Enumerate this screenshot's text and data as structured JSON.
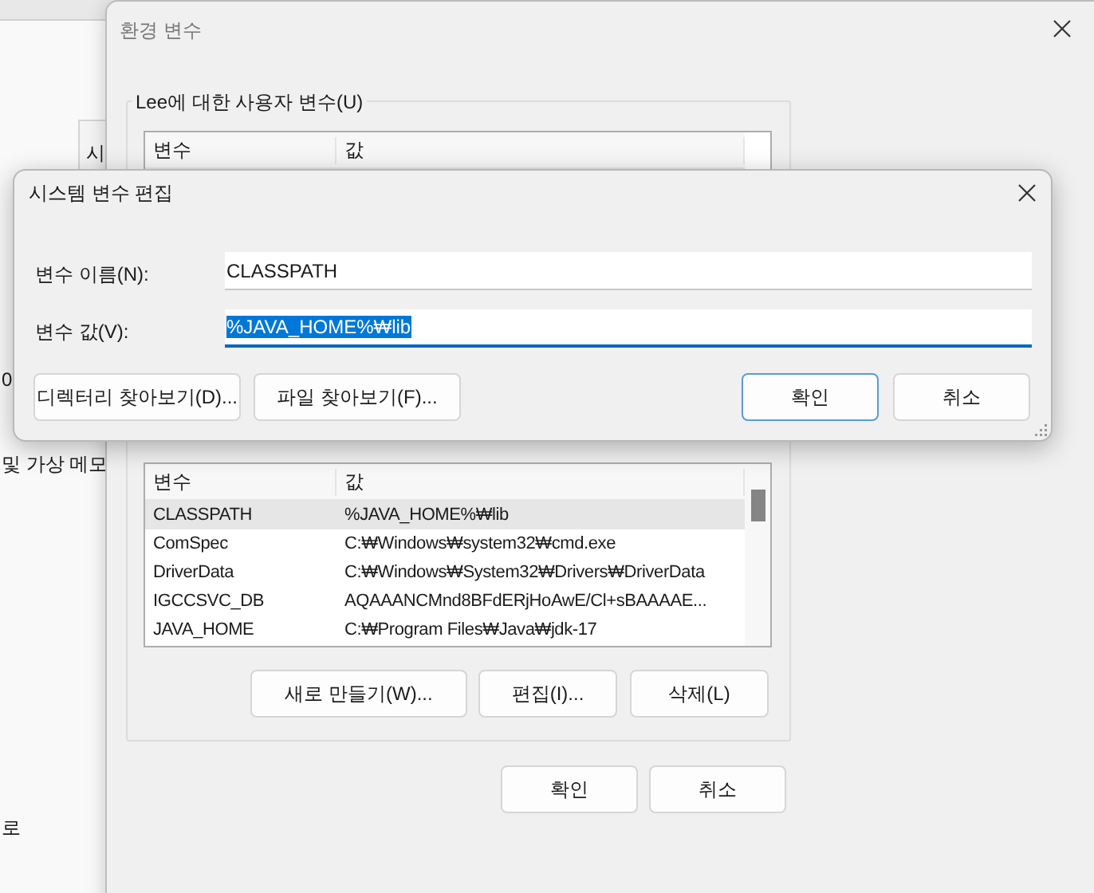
{
  "back_window": {
    "tab_fragment": "시",
    "texts": [
      "0",
      "및 가상 메모",
      "로"
    ]
  },
  "env_window": {
    "title": "환경 변수",
    "user_group": {
      "label": "Lee에 대한 사용자 변수(U)",
      "columns": [
        "변수",
        "값"
      ]
    },
    "system_table": {
      "columns": [
        "변수",
        "값"
      ],
      "rows": [
        {
          "name": "CLASSPATH",
          "value": "%JAVA_HOME%₩lib",
          "selected": true
        },
        {
          "name": "ComSpec",
          "value": "C:₩Windows₩system32₩cmd.exe",
          "selected": false
        },
        {
          "name": "DriverData",
          "value": "C:₩Windows₩System32₩Drivers₩DriverData",
          "selected": false
        },
        {
          "name": "IGCCSVC_DB",
          "value": "AQAAANCMnd8BFdERjHoAwE/Cl+sBAAAAE...",
          "selected": false
        },
        {
          "name": "JAVA_HOME",
          "value": "C:₩Program Files₩Java₩jdk-17",
          "selected": false
        }
      ]
    },
    "group_buttons": [
      "새로 만들기(W)...",
      "편집(I)...",
      "삭제(L)"
    ],
    "buttons": [
      "확인",
      "취소"
    ]
  },
  "edit_dialog": {
    "title": "시스템 변수 편집",
    "fields": [
      {
        "label": "변수 이름(N):",
        "value": "CLASSPATH",
        "focused": false,
        "text_selected": false
      },
      {
        "label": "변수 값(V):",
        "value": "%JAVA_HOME%₩lib",
        "focused": true,
        "text_selected": true
      }
    ],
    "browse_buttons": [
      "디렉터리 찾아보기(D)...",
      "파일 찾아보기(F)..."
    ],
    "buttons": [
      {
        "label": "확인",
        "default": true
      },
      {
        "label": "취소",
        "default": false
      }
    ]
  }
}
